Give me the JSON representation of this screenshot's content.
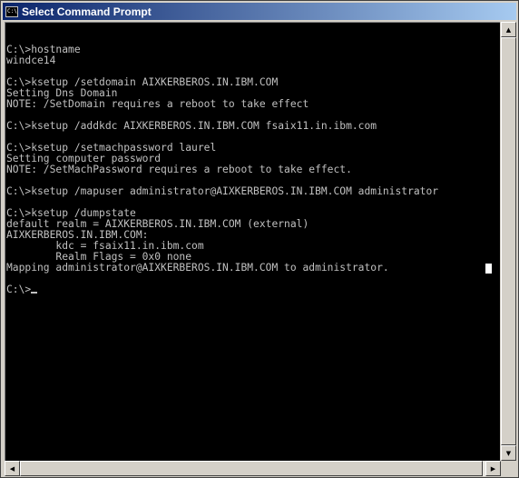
{
  "window": {
    "title": "Select Command Prompt",
    "icon_label": "C:\\",
    "icon": "console-icon"
  },
  "console": {
    "lines": [
      "",
      "C:\\>hostname",
      "windce14",
      "",
      "C:\\>ksetup /setdomain AIXKERBEROS.IN.IBM.COM",
      "Setting Dns Domain",
      "NOTE: /SetDomain requires a reboot to take effect",
      "",
      "C:\\>ksetup /addkdc AIXKERBEROS.IN.IBM.COM fsaix11.in.ibm.com",
      "",
      "C:\\>ksetup /setmachpassword laurel",
      "Setting computer password",
      "NOTE: /SetMachPassword requires a reboot to take effect.",
      "",
      "C:\\>ksetup /mapuser administrator@AIXKERBEROS.IN.IBM.COM administrator",
      "",
      "C:\\>ksetup /dumpstate",
      "default realm = AIXKERBEROS.IN.IBM.COM (external)",
      "AIXKERBEROS.IN.IBM.COM:",
      "        kdc = fsaix11.in.ibm.com",
      "        Realm Flags = 0x0 none",
      "Mapping administrator@AIXKERBEROS.IN.IBM.COM to administrator.",
      ""
    ],
    "prompt": "C:\\>",
    "colors": {
      "background": "#000000",
      "foreground": "#c0c0c0"
    }
  },
  "scrollbars": {
    "up_arrow": "▲",
    "down_arrow": "▼",
    "left_arrow": "◀",
    "right_arrow": "▶"
  }
}
